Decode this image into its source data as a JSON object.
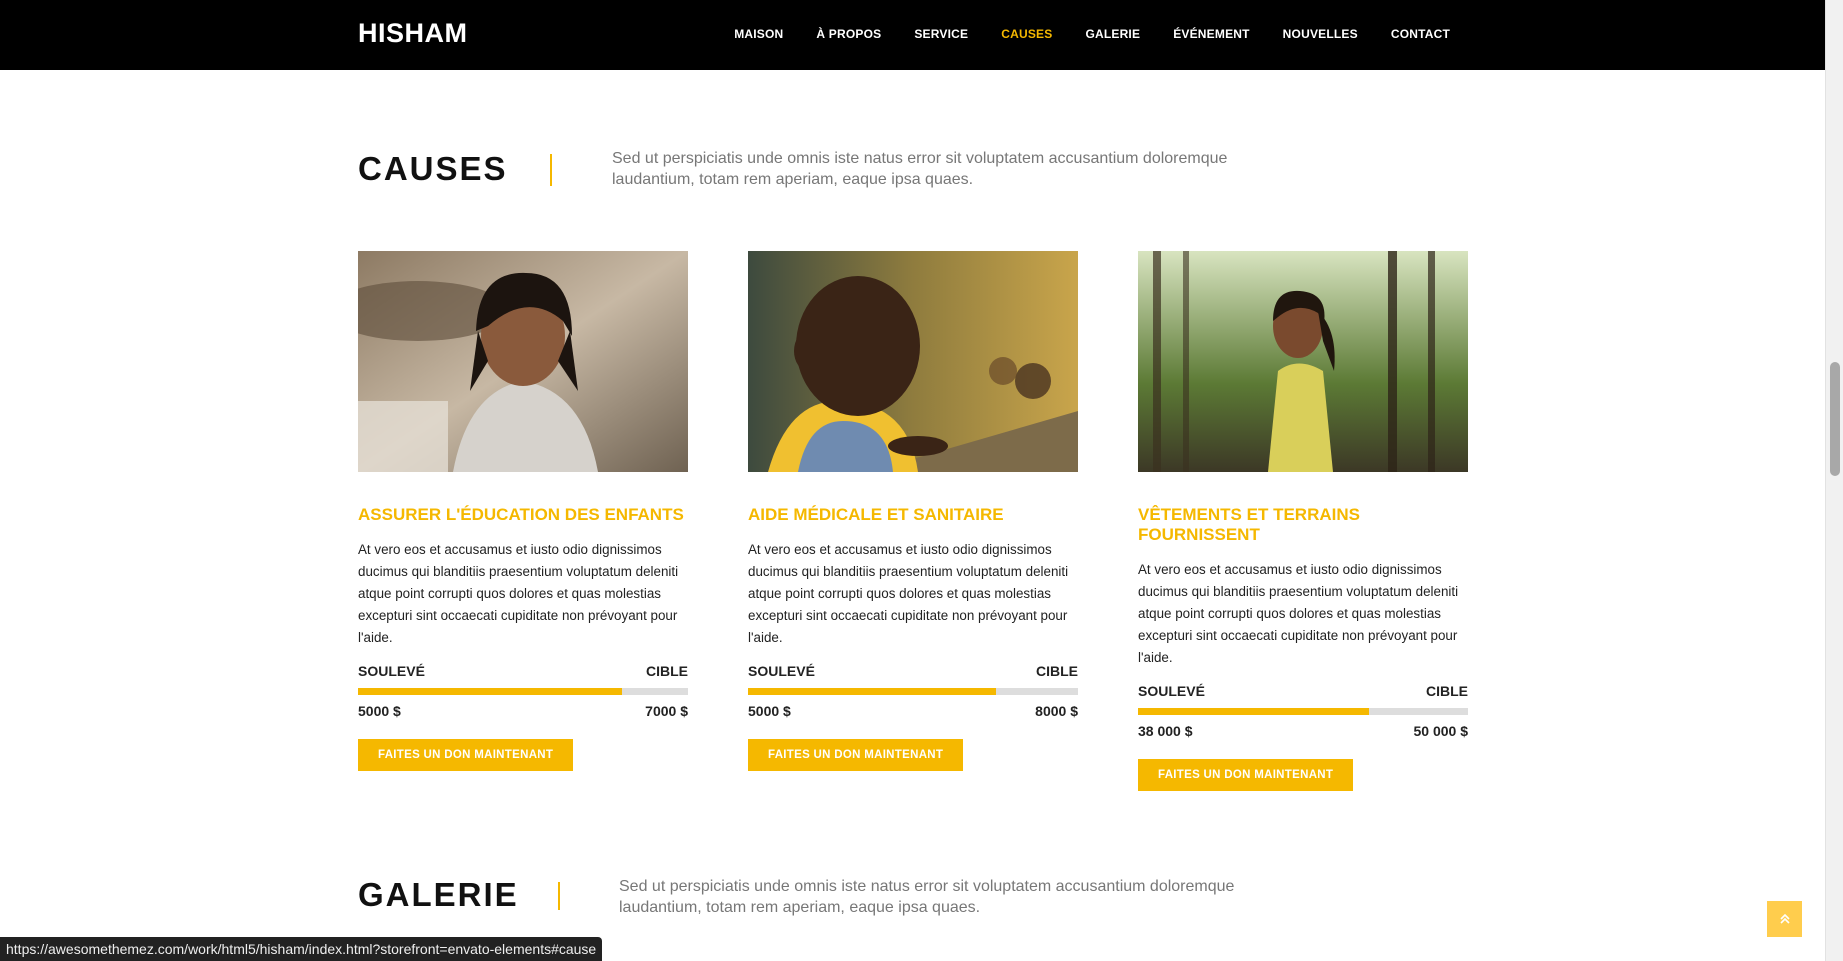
{
  "brand": "HISHAM",
  "nav": {
    "items": [
      {
        "label": "MAISON"
      },
      {
        "label": "À PROPOS"
      },
      {
        "label": "SERVICE"
      },
      {
        "label": "CAUSES",
        "active": true
      },
      {
        "label": "GALERIE"
      },
      {
        "label": "ÉVÉNEMENT"
      },
      {
        "label": "NOUVELLES"
      },
      {
        "label": "CONTACT"
      }
    ]
  },
  "causes_section": {
    "title": "CAUSES",
    "desc": "Sed ut perspiciatis unde omnis iste natus error sit voluptatem accusantium doloremque laudantium, totam rem aperiam, eaque ipsa quaes."
  },
  "cards": [
    {
      "title": "ASSURER L'ÉDUCATION DES ENFANTS",
      "text": "At vero eos et accusamus et iusto odio dignissimos ducimus qui blanditiis praesentium voluptatum deleniti atque point corrupti quos dolores et quas molestias excepturi sint occaecati cupiditate non prévoyant pour l'aide.",
      "raised_label": "SOULEVÉ",
      "target_label": "CIBLE",
      "raised": "5000 $",
      "target": "7000 $",
      "progress_pct": 80,
      "button": "FAITES UN DON MAINTENANT",
      "image": "girl-portrait-photo"
    },
    {
      "title": "AIDE MÉDICALE ET SANITAIRE",
      "text": "At vero eos et accusamus et iusto odio dignissimos ducimus qui blanditiis praesentium voluptatum deleniti atque point corrupti quos dolores et quas molestias excepturi sint occaecati cupiditate non prévoyant pour l'aide.",
      "raised_label": "SOULEVÉ",
      "target_label": "CIBLE",
      "raised": "5000 $",
      "target": "8000 $",
      "progress_pct": 75,
      "button": "FAITES UN DON MAINTENANT",
      "image": "boy-portrait-photo"
    },
    {
      "title": "VÊTEMENTS ET TERRAINS FOURNISSENT",
      "text": "At vero eos et accusamus et iusto odio dignissimos ducimus qui blanditiis praesentium voluptatum deleniti atque point corrupti quos dolores et quas molestias excepturi sint occaecati cupiditate non prévoyant pour l'aide.",
      "raised_label": "SOULEVÉ",
      "target_label": "CIBLE",
      "raised": "38 000 $",
      "target": "50 000 $",
      "progress_pct": 70,
      "button": "FAITES UN DON MAINTENANT",
      "image": "girl-in-forest-photo"
    }
  ],
  "gallery_section": {
    "title": "GALERIE",
    "desc": "Sed ut perspiciatis unde omnis iste natus error sit voluptatem accusantium doloremque laudantium, totam rem aperiam, eaque ipsa quaes."
  },
  "status_url": "https://awesomethemez.com/work/html5/hisham/index.html?storefront=envato-elements#cause",
  "back_to_top_icon": "double-chevron-up-icon",
  "colors": {
    "accent": "#f5b800",
    "nav_bg": "#000000"
  }
}
